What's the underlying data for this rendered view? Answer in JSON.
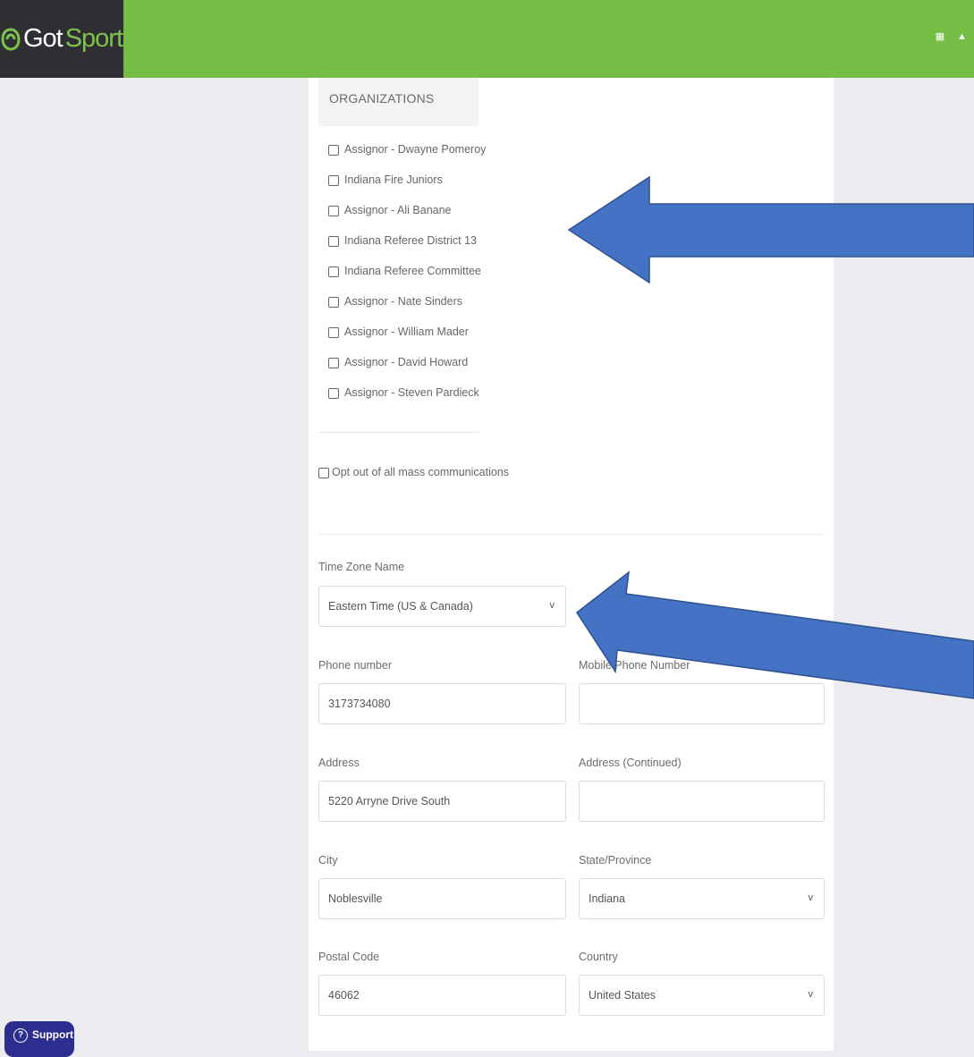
{
  "header": {
    "logo_got": "Got",
    "logo_sport": "Sport",
    "icons": [
      "grid-icon",
      "user-icon"
    ],
    "brand_color": "#75bd45"
  },
  "organizations": {
    "title": "ORGANIZATIONS",
    "items": [
      "Assignor - Dwayne Pomeroy",
      "Indiana Fire Juniors",
      "Assignor - Ali Banane",
      "Indiana Referee District 13",
      "Indiana Referee Committee",
      "Assignor - Nate Sinders",
      "Assignor - William Mader",
      "Assignor - David Howard",
      "Assignor - Steven Pardieck"
    ]
  },
  "opt_out_label": "Opt out of all mass communications",
  "form": {
    "time_zone": {
      "label": "Time Zone Name",
      "value": "Eastern Time (US & Canada)"
    },
    "phone": {
      "label": "Phone number",
      "value": "3173734080"
    },
    "mobile_phone": {
      "label": "Mobile Phone Number",
      "value": ""
    },
    "address": {
      "label": "Address",
      "value": "5220 Arryne Drive South"
    },
    "address2": {
      "label": "Address (Continued)",
      "value": ""
    },
    "city": {
      "label": "City",
      "value": "Noblesville"
    },
    "state": {
      "label": "State/Province",
      "value": "Indiana"
    },
    "postal": {
      "label": "Postal Code",
      "value": "46062"
    },
    "country": {
      "label": "Country",
      "value": "United States"
    }
  },
  "support": {
    "label": "Support"
  },
  "annotation_color": "#4472c4"
}
